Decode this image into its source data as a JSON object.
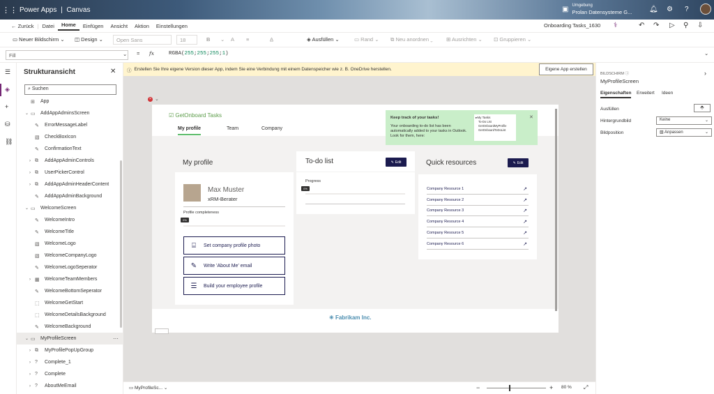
{
  "topbar": {
    "app_name": "Power Apps",
    "separator": "|",
    "mode": "Canvas",
    "env_label": "Umgebung",
    "env_name": "Prolan Datensysteme G..."
  },
  "cmdbar": {
    "back": "Zurück",
    "items": [
      "Datei",
      "Home",
      "Einfügen",
      "Ansicht",
      "Aktion",
      "Einstellungen"
    ],
    "active": "Home",
    "doc_title": "Onboarding Tasks_1630"
  },
  "ribbon": {
    "new_screen": "Neuer Bildschirm",
    "design": "Design",
    "font": "Open Sans",
    "size": "18",
    "fill": "Ausfüllen",
    "border": "Rand",
    "rearrange": "Neu anordnen",
    "align": "Ausrichten",
    "group": "Gruppieren"
  },
  "formula": {
    "property": "Fill",
    "eq": "=",
    "fx": "fx",
    "expr_fn": "RGBA(",
    "expr_args": [
      "255",
      "255",
      "255",
      "1"
    ],
    "expr_end": ")"
  },
  "tree": {
    "title": "Strukturansicht",
    "search_placeholder": "Suchen",
    "rows": [
      {
        "label": "App",
        "level": 0,
        "icon": "app-icon",
        "chev": ""
      },
      {
        "label": "AddAppAdminsScreen",
        "level": 0,
        "icon": "screen-icon",
        "chev": "v"
      },
      {
        "label": "ErrorMessageLabel",
        "level": 1,
        "icon": "edit-icon",
        "chev": ""
      },
      {
        "label": "CheckBoxIcon",
        "level": 1,
        "icon": "image-icon",
        "chev": ""
      },
      {
        "label": "ConfirmationText",
        "level": 1,
        "icon": "edit-icon",
        "chev": ""
      },
      {
        "label": "AddAppAdminControls",
        "level": 1,
        "icon": "group-icon",
        "chev": ">"
      },
      {
        "label": "UserPickerControl",
        "level": 1,
        "icon": "group-icon",
        "chev": ">"
      },
      {
        "label": "AddAppAdminHeaderContent",
        "level": 1,
        "icon": "group-icon",
        "chev": ">"
      },
      {
        "label": "AddAppAdminBackground",
        "level": 1,
        "icon": "edit-icon",
        "chev": ""
      },
      {
        "label": "WelcomeScreen",
        "level": 0,
        "icon": "screen-icon",
        "chev": "v"
      },
      {
        "label": "WelcomeIntro",
        "level": 1,
        "icon": "edit-icon",
        "chev": ""
      },
      {
        "label": "WelcomeTitle",
        "level": 1,
        "icon": "edit-icon",
        "chev": ""
      },
      {
        "label": "WelcomeLogo",
        "level": 1,
        "icon": "image-icon",
        "chev": ""
      },
      {
        "label": "WelcomeCompanyLogo",
        "level": 1,
        "icon": "image-icon",
        "chev": ""
      },
      {
        "label": "WelcomeLogoSeperator",
        "level": 1,
        "icon": "edit-icon",
        "chev": ""
      },
      {
        "label": "WelcomeTeamMembers",
        "level": 1,
        "icon": "gallery-icon",
        "chev": ">"
      },
      {
        "label": "WelcomeBottomSeperator",
        "level": 1,
        "icon": "edit-icon",
        "chev": ""
      },
      {
        "label": "WelcomeGetStart",
        "level": 1,
        "icon": "button-icon",
        "chev": ""
      },
      {
        "label": "WelcomeDetailsBackground",
        "level": 1,
        "icon": "button-icon",
        "chev": ""
      },
      {
        "label": "WelcomeBackground",
        "level": 1,
        "icon": "edit-icon",
        "chev": ""
      },
      {
        "label": "MyProfileScreen",
        "level": 0,
        "icon": "screen-icon",
        "chev": "v",
        "selected": true
      },
      {
        "label": "MyProfilePopUpGroup",
        "level": 1,
        "icon": "group-icon",
        "chev": ">"
      },
      {
        "label": "Complete_1",
        "level": 1,
        "icon": "help-icon",
        "chev": ">"
      },
      {
        "label": "Complete",
        "level": 1,
        "icon": "help-icon",
        "chev": ">"
      },
      {
        "label": "AboutMeEmail",
        "level": 1,
        "icon": "help-icon",
        "chev": ">"
      }
    ]
  },
  "notice": {
    "text": "Erstellen Sie Ihre eigene Version dieser App, indem Sie eine Verbindung mit einem Datenspeicher wie z. B. OneDrive herstellen.",
    "button": "Eigene App erstellen"
  },
  "app": {
    "brand": "GetOnboard Tasks",
    "tabs": [
      "My profile",
      "Team",
      "Company"
    ],
    "active_tab": "My profile",
    "popup": {
      "title": "Keep track of your tasks!",
      "body": "Your onboarding to-do list has been automatically added to your tasks in Outlook. Look for them, here:",
      "mini_title": "My Tasks",
      "mini_items": [
        "To-Do List",
        "GetOnboardMyProfile",
        "GetOnboardToDoList"
      ]
    },
    "profile": {
      "title": "My profile",
      "name": "Max Muster",
      "role": "xRM-Berater",
      "completeness_label": "Profile completeness",
      "completeness_badge": "0%",
      "completeness": 0,
      "actions": [
        {
          "label": "Set company profile photo",
          "icon": "camera-icon"
        },
        {
          "label": "Write 'About Me' email",
          "icon": "compose-icon"
        },
        {
          "label": "Build your employee profile",
          "icon": "contact-card-icon"
        }
      ]
    },
    "todo": {
      "title": "To-do list",
      "edit": "Edit",
      "progress_label": "Progress",
      "progress_badge": "0%",
      "progress": 0
    },
    "resources": {
      "title": "Quick resources",
      "edit": "Edit",
      "items": [
        "Company Resource 1",
        "Company Resource 2",
        "Company Resource 3",
        "Company Resource 4",
        "Company Resource 5",
        "Company Resource 6"
      ]
    },
    "footer_brand": "Fabrikam Inc."
  },
  "right_panel": {
    "section": "BILDSCHIRM",
    "screen_name": "MyProfileScreen",
    "tabs": [
      "Eigenschaften",
      "Erweitert",
      "Ideen"
    ],
    "active_tab": "Eigenschaften",
    "fill_label": "Ausfüllen",
    "bg_image_label": "Hintergrundbild",
    "bg_image_value": "Keine",
    "image_pos_label": "Bildposition",
    "image_pos_value": "Anpassen"
  },
  "status": {
    "screen": "MyProfileSc...",
    "zoom_minus": "−",
    "zoom_plus": "+",
    "zoom": "80 %",
    "zoom_value": 80
  },
  "colors": {
    "accent": "#742774",
    "brand_green": "#5cbc6a",
    "navy": "#1b1b4f",
    "notice": "#fff4ce",
    "popup": "#c9eec9"
  }
}
